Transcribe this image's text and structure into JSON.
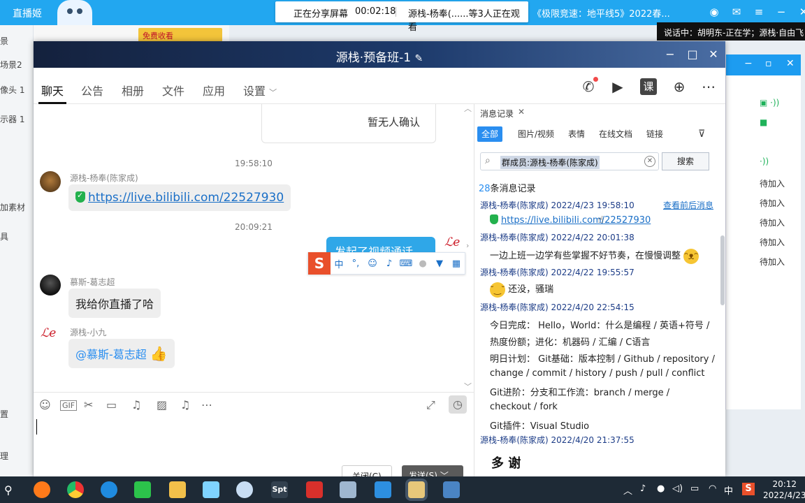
{
  "top_bar": {
    "app_name": "直播姬",
    "share_status": "正在分享屏幕",
    "share_time": "00:02:18",
    "viewers": "源栈-杨奉(......等3人正在观看",
    "marquee": "《极限竞速：地平线5》2022春...",
    "speaking": "说话中：胡明东-正在学；源栈·自由飞"
  },
  "bg_left": {
    "items": [
      "景",
      "场景2",
      "像头 1",
      "示器 1",
      "加素材",
      "具",
      "置",
      "理"
    ],
    "ad_text": "免费收看"
  },
  "bg_right": {
    "rows": [
      "待加入",
      "待加入",
      "待加入",
      "待加入",
      "待加入"
    ]
  },
  "window": {
    "title": "源栈·预备班-1",
    "tabs": [
      "聊天",
      "公告",
      "相册",
      "文件",
      "应用",
      "设置"
    ],
    "toolbar_class_label": "课"
  },
  "messages": {
    "confirm_text": "暂无人确认",
    "time1": "19:58:10",
    "m1_sender": "源栈-杨奉(陈家成)",
    "m1_text": "https://live.bilibili.com/22527930",
    "time2": "20:09:21",
    "mine_text": "发起了视频通话",
    "m2_sender": "慕斯-葛志超",
    "m2_text": "我给你直播了哈",
    "m3_sender": "源栈-小九",
    "m3_text": "@慕斯-葛志超"
  },
  "ime": {
    "logo": "S",
    "lang": "中"
  },
  "input": {
    "close_label": "关闭(C)",
    "send_label": "发送(S)"
  },
  "records": {
    "title": "消息记录",
    "filters": [
      "全部",
      "图片/视频",
      "表情",
      "在线文档",
      "链接"
    ],
    "search_query": "群成员:源栈-杨奉(陈家成)",
    "search_button": "搜索",
    "count_num": "28",
    "count_suffix": "条消息记录",
    "context_link": "查看前后消息",
    "entries": [
      {
        "meta": "源栈-杨奉(陈家成) 2022/4/23 19:58:10"
      },
      {
        "link": "https://live.bilibili.com/22527930"
      },
      {
        "meta": "源栈-杨奉(陈家成) 2022/4/22 20:01:38"
      },
      {
        "body": "一边上班一边学有些掌握不好节奏，在慢慢调整"
      },
      {
        "meta": "源栈-杨奉(陈家成) 2022/4/22 19:55:57"
      },
      {
        "body": "还没，骚瑞"
      },
      {
        "meta": "源栈-杨奉(陈家成) 2022/4/20 22:54:15"
      },
      {
        "body": "今日完成： Hello，World：什么是编程 / 英语+符号 /"
      },
      {
        "body": "热度份额；进化：机器码 / 汇编 / C语言"
      },
      {
        "body": "明日计划： Git基础：版本控制 / Github / repository /"
      },
      {
        "body": "change / commit / history / push / pull / conflict"
      },
      {
        "body": "Git进阶：分支和工作流：branch / merge /"
      },
      {
        "body": "checkout / fork"
      },
      {
        "body": "Git插件：Visual Studio"
      },
      {
        "meta": "源栈-杨奉(陈家成) 2022/4/20 21:37:55"
      }
    ],
    "sticker": "多   谢"
  },
  "taskbar": {
    "ime": "中",
    "time": "20:12",
    "date": "2022/4/23"
  }
}
